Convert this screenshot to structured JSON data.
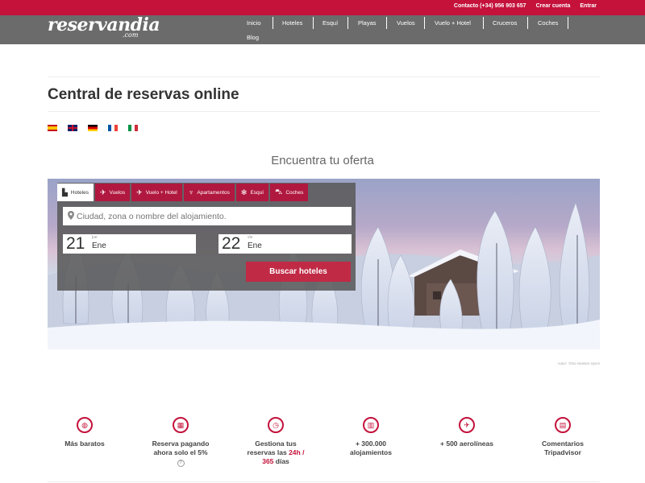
{
  "topbar": {
    "contact": "Contacto (+34) 956 903 657",
    "create_account": "Crear cuenta",
    "login": "Entrar"
  },
  "logo": {
    "main": "reservandia",
    "sub": ".com"
  },
  "nav": [
    "Inicio",
    "Hoteles",
    "Esquí",
    "Playas",
    "Vuelos",
    "Vuelo + Hotel",
    "Cruceros",
    "Coches",
    "Blog"
  ],
  "page_title": "Central de reservas online",
  "languages": [
    "es",
    "en",
    "de",
    "fr",
    "it"
  ],
  "search": {
    "heading": "Encuentra tu oferta",
    "tabs": [
      {
        "label": "Hoteles",
        "icon": "building-icon",
        "active": true
      },
      {
        "label": "Vuelos",
        "icon": "plane-icon"
      },
      {
        "label": "Vuelo + Hotel",
        "icon": "plane-hotel-icon"
      },
      {
        "label": "Apartamentos",
        "icon": "apartment-icon"
      },
      {
        "label": "Esquí",
        "icon": "snowflake-icon"
      },
      {
        "label": "Coches",
        "icon": "car-icon"
      }
    ],
    "placeholder": "Ciudad, zona o nombre del alojamiento.",
    "checkin": {
      "day": "21",
      "dow": "jue",
      "month": "Ene"
    },
    "checkout": {
      "day": "22",
      "dow": "vie",
      "month": "Ene"
    },
    "button": "Buscar hoteles"
  },
  "photo_credit": "Autor: Timo Newton-Syms",
  "features": [
    {
      "icon": "piggy-bank-icon",
      "line1": "Más baratos",
      "line2": ""
    },
    {
      "icon": "calendar-percent-icon",
      "line1": "Reserva pagando",
      "line2": "ahora solo el 5%",
      "help": "?"
    },
    {
      "icon": "clock-icon",
      "line1": "Gestiona tus",
      "line2a": "reservas las ",
      "hl1": "24h /",
      "hl2": "365",
      "line3b": " días"
    },
    {
      "icon": "hotel-icon",
      "line1": "+ 300.000",
      "line2": "alojamientos"
    },
    {
      "icon": "plane-icon",
      "line1": "+ 500 aerolíneas",
      "line2": ""
    },
    {
      "icon": "review-icon",
      "line1": "Comentarios",
      "line2": "Tripadvisor"
    }
  ],
  "colors": {
    "brand": "#c4123b",
    "nav_bg": "#6b6b6b",
    "button": "#c02a45"
  }
}
